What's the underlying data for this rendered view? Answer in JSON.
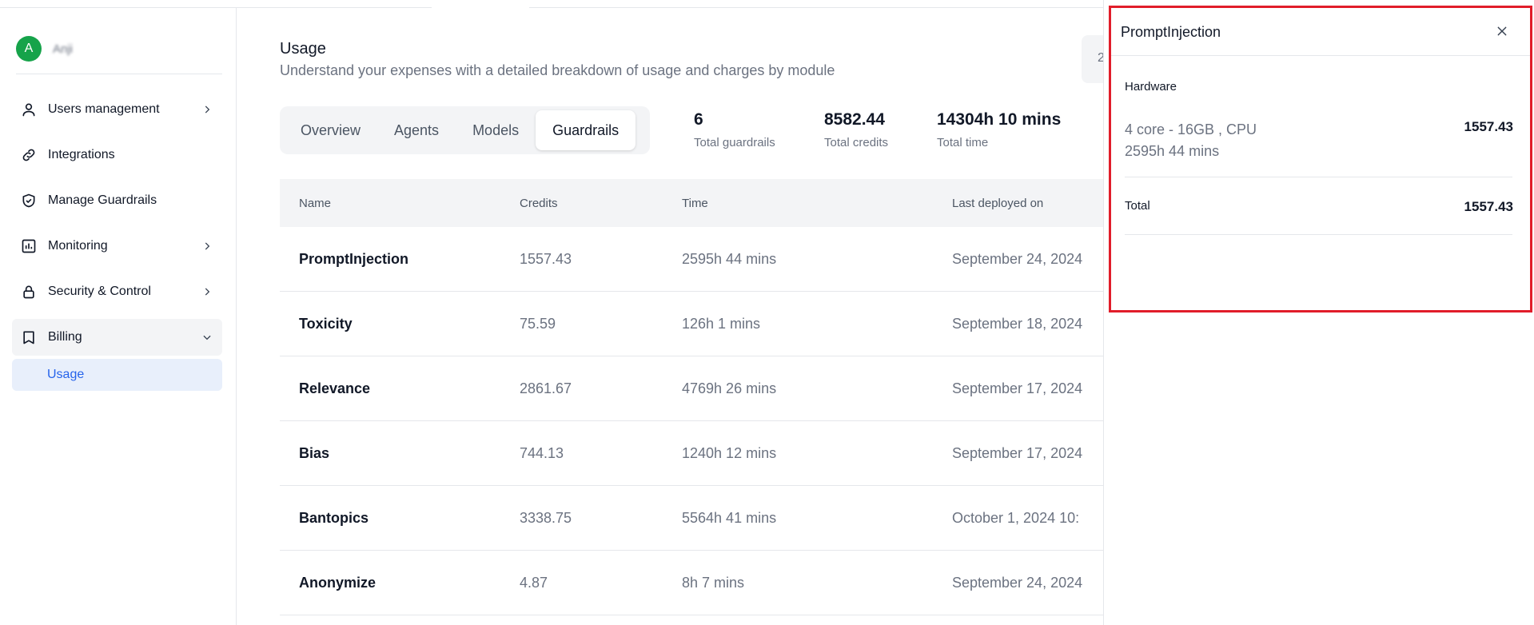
{
  "user": {
    "initial": "A",
    "name": "Anji"
  },
  "sidebar": {
    "items": [
      {
        "label": "Users management",
        "icon": "user-icon",
        "chevron": "right"
      },
      {
        "label": "Integrations",
        "icon": "link-icon",
        "chevron": ""
      },
      {
        "label": "Manage Guardrails",
        "icon": "shield-check-icon",
        "chevron": ""
      },
      {
        "label": "Monitoring",
        "icon": "chart-icon",
        "chevron": "right"
      },
      {
        "label": "Security & Control",
        "icon": "lock-icon",
        "chevron": "right"
      },
      {
        "label": "Billing",
        "icon": "book-icon",
        "chevron": "down"
      }
    ],
    "sub_item": "Usage"
  },
  "page": {
    "title": "Usage",
    "subtitle": "Understand your expenses with a detailed breakdown of usage and charges by module",
    "date_btn": "2"
  },
  "tabs": [
    "Overview",
    "Agents",
    "Models",
    "Guardrails"
  ],
  "active_tab": "Guardrails",
  "stats": [
    {
      "value": "6",
      "label": "Total guardrails"
    },
    {
      "value": "8582.44",
      "label": "Total credits"
    },
    {
      "value": "14304h 10 mins",
      "label": "Total time"
    }
  ],
  "table": {
    "headers": [
      "Name",
      "Credits",
      "Time",
      "Last deployed on"
    ],
    "rows": [
      {
        "name": "PromptInjection",
        "credits": "1557.43",
        "time": "2595h 44 mins",
        "date": "September 24, 2024"
      },
      {
        "name": "Toxicity",
        "credits": "75.59",
        "time": "126h 1 mins",
        "date": "September 18, 2024"
      },
      {
        "name": "Relevance",
        "credits": "2861.67",
        "time": "4769h 26 mins",
        "date": "September 17, 2024"
      },
      {
        "name": "Bias",
        "credits": "744.13",
        "time": "1240h 12 mins",
        "date": "September 17, 2024"
      },
      {
        "name": "Bantopics",
        "credits": "3338.75",
        "time": "5564h 41 mins",
        "date": "October 1, 2024 10:"
      },
      {
        "name": "Anonymize",
        "credits": "4.87",
        "time": "8h 7 mins",
        "date": "September 24, 2024"
      }
    ]
  },
  "drawer": {
    "title": "PromptInjection",
    "section": "Hardware",
    "spec_line1": "4 core - 16GB , CPU",
    "spec_line2": "2595h 44 mins",
    "spec_value": "1557.43",
    "total_label": "Total",
    "total_value": "1557.43"
  },
  "colors": {
    "accent": "#2563eb",
    "avatar": "#16a34a",
    "highlight": "#e11d2a"
  }
}
